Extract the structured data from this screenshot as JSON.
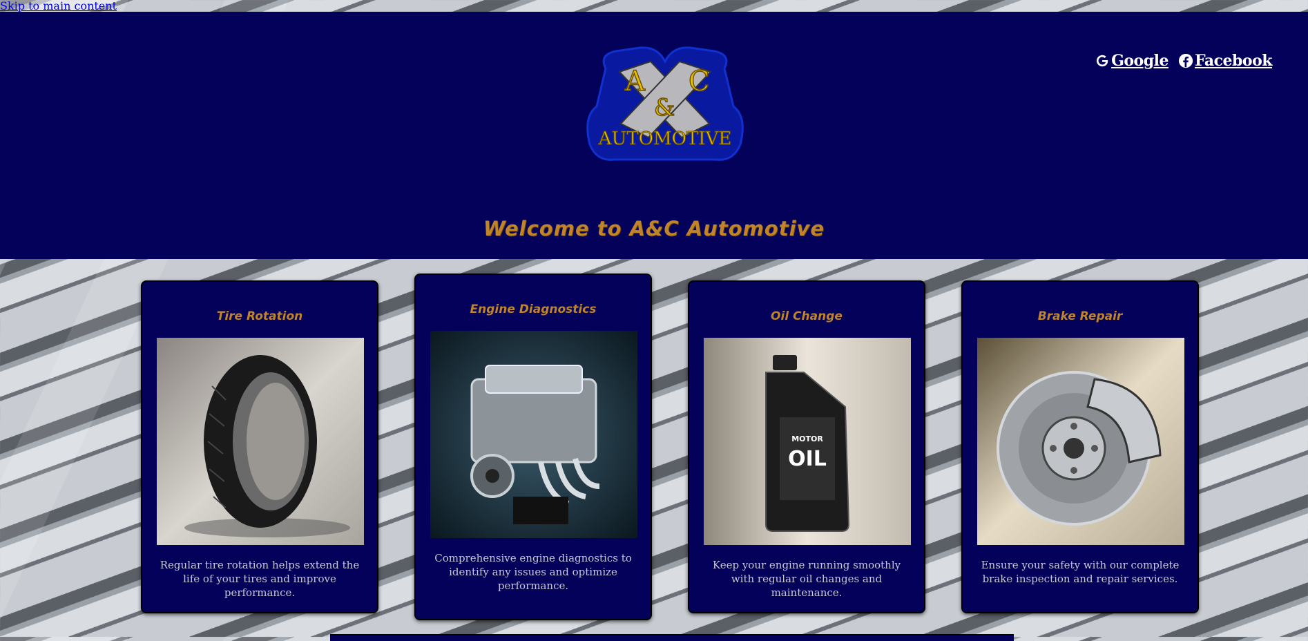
{
  "skip_link": "Skip to main content",
  "header": {
    "logo_alt": "A&C Automotive",
    "logo_letters": [
      "A",
      "C",
      "&",
      "AUTOMOTIVE"
    ],
    "welcome": "Welcome to A&C Automotive",
    "social": [
      {
        "label": "Google",
        "icon": "google-icon"
      },
      {
        "label": "Facebook",
        "icon": "facebook-icon"
      }
    ]
  },
  "services": [
    {
      "title": "Tire Rotation",
      "desc": "Regular tire rotation helps extend the life of your tires and improve performance.",
      "image": "tire-image"
    },
    {
      "title": "Engine Diagnostics",
      "desc": "Comprehensive engine diagnostics to identify any issues and optimize performance.",
      "image": "engine-image"
    },
    {
      "title": "Oil Change",
      "desc": "Keep your engine running smoothly with regular oil changes and maintenance.",
      "image": "oil-bottle-image"
    },
    {
      "title": "Brake Repair",
      "desc": "Ensure your safety with our complete brake inspection and repair services.",
      "image": "brake-image"
    }
  ],
  "oil_label": {
    "line1": "MOTOR",
    "line2": "OIL"
  },
  "colors": {
    "header_bg": "#03015a",
    "accent": "#c0842a",
    "text": "#c8c8d4"
  }
}
